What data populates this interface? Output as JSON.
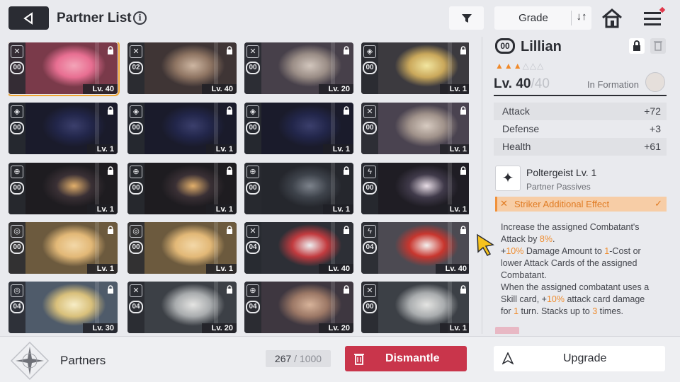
{
  "header": {
    "title": "Partner List",
    "info_glyph": "i",
    "sort_button": "Grade",
    "sort_glyph": "↓↑"
  },
  "grid": {
    "cards": [
      {
        "rank": "00",
        "level": "Lv. 40",
        "class_icon": "sword-icon",
        "locked": true,
        "art": [
          "#f3a4b8",
          "#e86f92",
          "#7a3a4a"
        ],
        "selected": true
      },
      {
        "rank": "02",
        "level": "Lv. 40",
        "class_icon": "sword-icon",
        "locked": true,
        "art": [
          "#cdb6a2",
          "#8f7563",
          "#3f3535"
        ]
      },
      {
        "rank": "00",
        "level": "Lv. 20",
        "class_icon": "sword-icon",
        "locked": true,
        "art": [
          "#d2c6bd",
          "#9a8d86",
          "#47404a"
        ]
      },
      {
        "rank": "00",
        "level": "Lv. 1",
        "class_icon": "shield-icon",
        "locked": true,
        "art": [
          "#f2e6a0",
          "#caa85b",
          "#3c3a3f"
        ]
      },
      {
        "rank": "00",
        "level": "Lv. 1",
        "class_icon": "shield-icon",
        "locked": true,
        "art": [
          "#3b3f6c",
          "#22264a",
          "#1a1b2b"
        ]
      },
      {
        "rank": "00",
        "level": "Lv. 1",
        "class_icon": "shield-icon",
        "locked": true,
        "art": [
          "#3b3f6c",
          "#22264a",
          "#1a1b2b"
        ]
      },
      {
        "rank": "00",
        "level": "Lv. 1",
        "class_icon": "shield-icon",
        "locked": true,
        "art": [
          "#3b3f6c",
          "#22264a",
          "#1a1b2b"
        ]
      },
      {
        "rank": "00",
        "level": "Lv. 1",
        "class_icon": "sword-icon",
        "locked": true,
        "art": [
          "#d7cbc1",
          "#a0928a",
          "#4a4350"
        ]
      },
      {
        "rank": "00",
        "level": "Lv. 1",
        "class_icon": "target-icon",
        "locked": true,
        "art": [
          "#e3b06b",
          "#3a3035",
          "#1e1c20"
        ]
      },
      {
        "rank": "00",
        "level": "Lv. 1",
        "class_icon": "target-icon",
        "locked": true,
        "art": [
          "#e3b06b",
          "#3a3035",
          "#1e1c20"
        ]
      },
      {
        "rank": "00",
        "level": "Lv. 1",
        "class_icon": "target-icon",
        "locked": true,
        "art": [
          "#7d838c",
          "#3e434b",
          "#25272d"
        ]
      },
      {
        "rank": "00",
        "level": "Lv. 1",
        "class_icon": "bolt-icon",
        "locked": true,
        "art": [
          "#e8dde6",
          "#403a4a",
          "#1f1d24"
        ]
      },
      {
        "rank": "00",
        "level": "Lv. 1",
        "class_icon": "circle-icon",
        "locked": true,
        "art": [
          "#f3d8a8",
          "#e2b877",
          "#6c5a3e"
        ]
      },
      {
        "rank": "00",
        "level": "Lv. 1",
        "class_icon": "circle-icon",
        "locked": true,
        "art": [
          "#f3d8a8",
          "#e2b877",
          "#6c5a3e"
        ]
      },
      {
        "rank": "04",
        "level": "Lv. 40",
        "class_icon": "sword-icon",
        "locked": true,
        "art": [
          "#eef0f2",
          "#c23b3f",
          "#2d2f36"
        ]
      },
      {
        "rank": "04",
        "level": "Lv. 40",
        "class_icon": "bolt-icon",
        "locked": true,
        "art": [
          "#f4f1ef",
          "#c8362e",
          "#4c4a52"
        ]
      },
      {
        "rank": "04",
        "level": "Lv. 30",
        "class_icon": "circle-icon",
        "locked": true,
        "art": [
          "#f7edc6",
          "#d9c07b",
          "#4f5b6a"
        ]
      },
      {
        "rank": "04",
        "level": "Lv. 20",
        "class_icon": "sword-icon",
        "locked": true,
        "art": [
          "#e4e4e2",
          "#a9acae",
          "#3c4046"
        ]
      },
      {
        "rank": "04",
        "level": "Lv. 20",
        "class_icon": "target-icon",
        "locked": true,
        "art": [
          "#d7b39a",
          "#9c7866",
          "#3e3740"
        ]
      },
      {
        "rank": "00",
        "level": "Lv. 1",
        "class_icon": "sword-icon",
        "locked": true,
        "art": [
          "#e4e4e2",
          "#a9acae",
          "#3c4046"
        ]
      }
    ]
  },
  "panel": {
    "rank": "00",
    "name": "Lillian",
    "stars_filled": 3,
    "stars_total": 6,
    "level_current": "Lv. 40",
    "level_max": "/40",
    "in_formation": "In Formation",
    "level_fill": 1.0,
    "stats": [
      {
        "name": "Attack",
        "value": "+72"
      },
      {
        "name": "Defense",
        "value": "+3"
      },
      {
        "name": "Health",
        "value": "+61"
      }
    ],
    "passive_name": "Poltergeist Lv. 1",
    "passive_type": "Partner Passives",
    "effect_label": "Striker Additional Effect",
    "description": {
      "l1": "Increase the assigned Combatant's",
      "l2a": "Attack by ",
      "l2b": "8%",
      "l2c": ".",
      "l3a": "+",
      "l3b": "10%",
      "l3c": " Damage Amount to ",
      "l3d": "1",
      "l3e": "-Cost or",
      "l4": "lower Attack Cards of the assigned",
      "l5": "Combatant.",
      "l6": "When the assigned combatant uses a",
      "l7a": "Skill card, +",
      "l7b": "10%",
      "l7c": " attack card damage",
      "l8a": "for ",
      "l8b": "1",
      "l8c": " turn. Stacks up to ",
      "l8d": "3",
      "l8e": " times."
    }
  },
  "footer": {
    "section_label": "Partners",
    "count": "267",
    "count_total": " / 1000",
    "dismantle_label": "Dismantle",
    "upgrade_label": "Upgrade"
  },
  "colors": {
    "accent_orange": "#f08a2b",
    "dismantle_red": "#c9354b",
    "selected_outline": "#f0a531"
  }
}
